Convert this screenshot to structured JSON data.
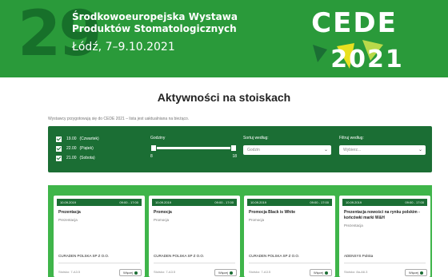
{
  "banner": {
    "number": "29",
    "title_line1": "Środkowoeuropejska Wystawa",
    "title_line2": "Produktów Stomatologicznych",
    "date": "Łódź, 7–9.10.2021",
    "logo_text_top": "CEDE",
    "logo_text_bottom": "2021"
  },
  "section": {
    "title": "Aktywności na stoiskach",
    "intro": "Wystawcy przygotowują się do CEDE 2021 – lista jest uaktualniana na bieżąco."
  },
  "filters": {
    "days": [
      {
        "time": "19.00",
        "day": "(Czwartek)"
      },
      {
        "time": "22.00",
        "day": "(Piątek)"
      },
      {
        "time": "21.00",
        "day": "(Sobota)"
      }
    ],
    "hours_label": "Godziny",
    "hours_min": "8",
    "hours_max": "18",
    "sort_label": "Sortuj według:",
    "sort_value": "Godzin",
    "filter_label": "Filtruj według:",
    "filter_value": "Wybierz..."
  },
  "cards": [
    {
      "date": "10.09.2019",
      "time": "09:00 - 17:00",
      "title": "Prezentacja",
      "type": "Prezentacja",
      "company": "CURADEN POLSKA SP Z O.O.",
      "stand": "Stoisko: 7-A3.5",
      "button": "Więcej"
    },
    {
      "date": "10.09.2019",
      "time": "09:00 - 17:00",
      "title": "Promocja",
      "type": "Promocja",
      "company": "CURADEN POLSKA SP Z O.O.",
      "stand": "Stoisko: 7-A3.5",
      "button": "Więcej"
    },
    {
      "date": "10.09.2019",
      "time": "09:00 - 17:00",
      "title": "Promocja Black is White",
      "type": "Promocja",
      "company": "CURADEN POLSKA SP Z O.O.",
      "stand": "Stoisko: 7-A3.5",
      "button": "Więcej"
    },
    {
      "date": "10.09.2019",
      "time": "09:00 - 17:00",
      "title": "Prezentacja nowości na rynku polskim - końcówki marki W&H",
      "type": "Prezentacja",
      "company": "ADENSYS Polska",
      "stand": "Stoisko: 8a-A6.3",
      "button": "Więcej"
    }
  ],
  "colors": {
    "banner_green": "#2a9a3a",
    "panel_green": "#1b6e34",
    "cards_green": "#3fb54a",
    "logo_yellow": "#e8e020"
  }
}
